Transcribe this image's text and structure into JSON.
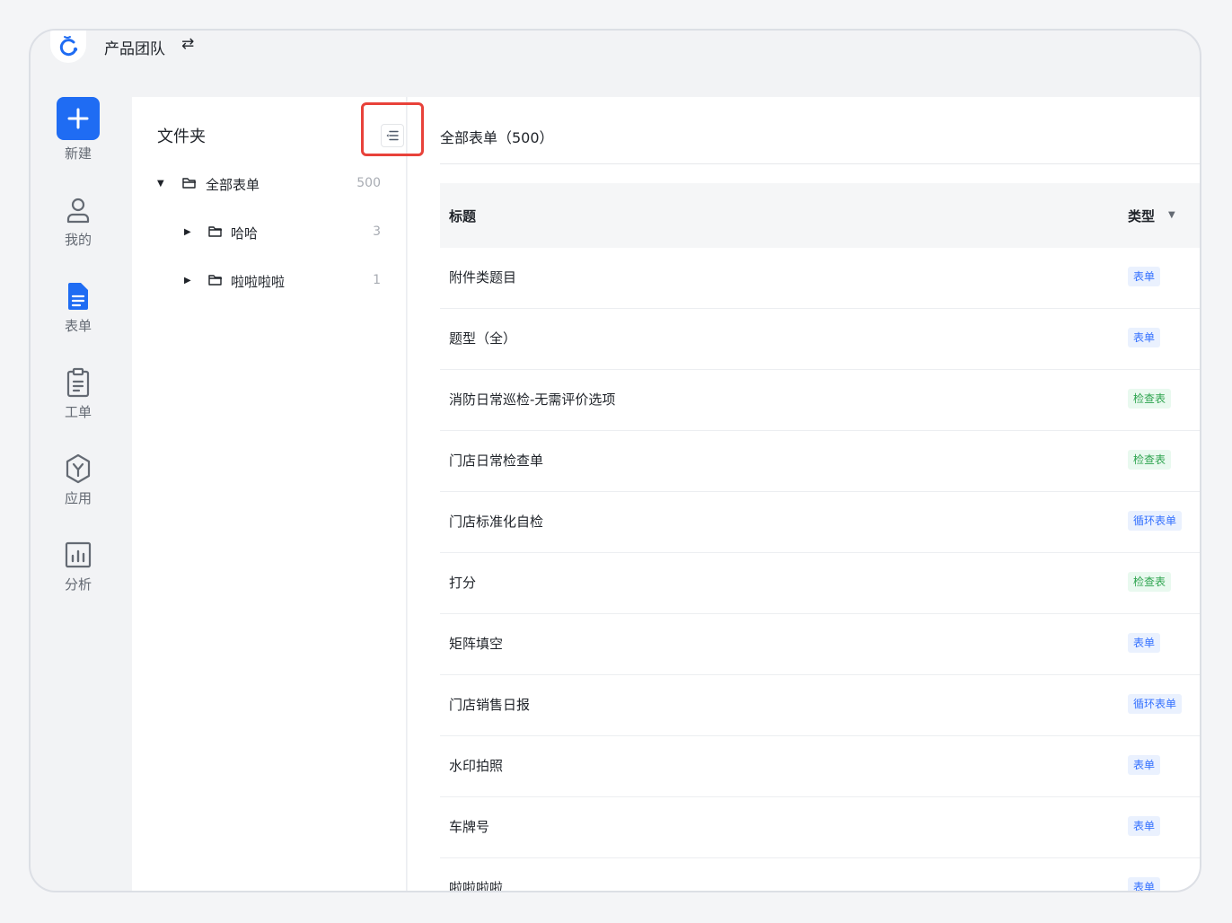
{
  "header": {
    "team_name": "产品团队",
    "switch_icon": "swap-icon"
  },
  "rail": {
    "items": [
      {
        "label": "新建",
        "icon": "plus-icon"
      },
      {
        "label": "我的",
        "icon": "user-icon"
      },
      {
        "label": "表单",
        "icon": "form-doc-icon"
      },
      {
        "label": "工单",
        "icon": "clipboard-icon"
      },
      {
        "label": "应用",
        "icon": "app-hexagon-icon"
      },
      {
        "label": "分析",
        "icon": "chart-icon"
      }
    ],
    "active_color": "#1f6cf3"
  },
  "folders": {
    "title": "文件夹",
    "tree": [
      {
        "name": "全部表单",
        "count": "500"
      },
      {
        "name": "哈哈",
        "count": "3"
      },
      {
        "name": "啦啦啦啦",
        "count": "1"
      }
    ]
  },
  "main": {
    "title": "全部表单（500）",
    "columns": {
      "title": "标题",
      "type": "类型"
    },
    "rows": [
      {
        "title": "附件类题目",
        "type": "表单",
        "color": "blue"
      },
      {
        "title": "题型（全）",
        "type": "表单",
        "color": "blue"
      },
      {
        "title": "消防日常巡检-无需评价选项",
        "type": "检查表",
        "color": "green"
      },
      {
        "title": "门店日常检查单",
        "type": "检查表",
        "color": "green"
      },
      {
        "title": "门店标准化自检",
        "type": "循环表单",
        "color": "blue"
      },
      {
        "title": "打分",
        "type": "检查表",
        "color": "green"
      },
      {
        "title": "矩阵填空",
        "type": "表单",
        "color": "blue"
      },
      {
        "title": "门店销售日报",
        "type": "循环表单",
        "color": "blue"
      },
      {
        "title": "水印拍照",
        "type": "表单",
        "color": "blue"
      },
      {
        "title": "车牌号",
        "type": "表单",
        "color": "blue"
      },
      {
        "title": "啦啦啦啦",
        "type": "表单",
        "color": "blue"
      }
    ]
  },
  "colors": {
    "highlight": "#e8423a",
    "tag_blue": "#3370ff",
    "tag_green": "#2ea44f"
  }
}
